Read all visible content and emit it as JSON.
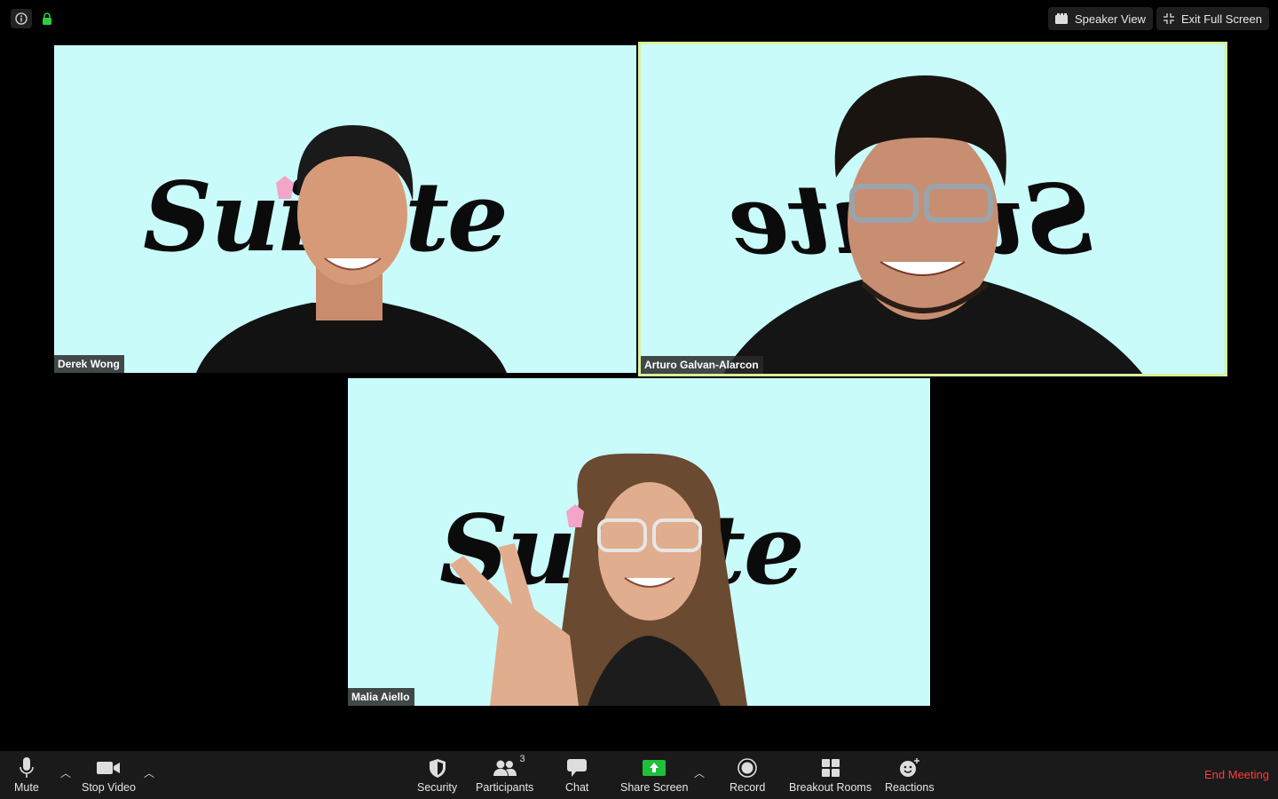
{
  "top": {
    "speaker_view_label": "Speaker View",
    "exit_full_screen_label": "Exit Full Screen"
  },
  "participants": [
    {
      "name": "Derek Wong"
    },
    {
      "name": "Arturo Galvan-Alarcon"
    },
    {
      "name": "Malia Aiello"
    }
  ],
  "background_text": "Sui        ate",
  "toolbar": {
    "mute_label": "Mute",
    "stop_video_label": "Stop Video",
    "security_label": "Security",
    "participants_label": "Participants",
    "participants_count": "3",
    "chat_label": "Chat",
    "share_screen_label": "Share Screen",
    "record_label": "Record",
    "breakout_rooms_label": "Breakout Rooms",
    "reactions_label": "Reactions",
    "end_meeting_label": "End Meeting"
  },
  "colors": {
    "background": "#000000",
    "tile_bg": "#c9fbfb",
    "active_border": "#d8f29a",
    "share_green": "#1fbf3a",
    "end_red": "#ff3b3b"
  }
}
